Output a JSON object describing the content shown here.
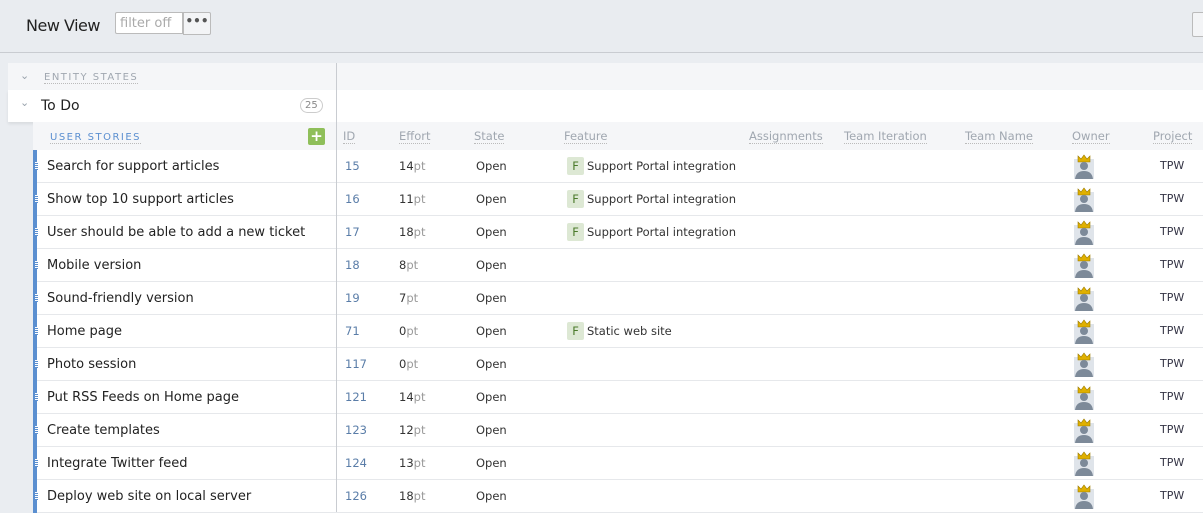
{
  "header": {
    "title": "New View",
    "filter_placeholder": "filter off",
    "more_label": "•••"
  },
  "groups": {
    "entity_states_label": "ENTITY STATES",
    "todo_label": "To Do",
    "todo_count": "25",
    "user_stories_label": "USER STORIES",
    "add_label": "+"
  },
  "columns": [
    "ID",
    "Effort",
    "State",
    "Feature",
    "Assignments",
    "Team Iteration",
    "Team Name",
    "Owner",
    "Project"
  ],
  "colors": {
    "accent": "#5b8fd0",
    "add": "#8fbf5a",
    "feature_badge": "#dde8d4"
  },
  "rows": [
    {
      "name": "Search for support articles",
      "id": "15",
      "effort": "14",
      "unit": "pt",
      "state": "Open",
      "feature": "Support Portal integration",
      "project": "TPW"
    },
    {
      "name": "Show top 10 support articles",
      "id": "16",
      "effort": "11",
      "unit": "pt",
      "state": "Open",
      "feature": "Support Portal integration",
      "project": "TPW"
    },
    {
      "name": "User should be able to add a new ticket",
      "id": "17",
      "effort": "18",
      "unit": "pt",
      "state": "Open",
      "feature": "Support Portal integration",
      "project": "TPW"
    },
    {
      "name": "Mobile version",
      "id": "18",
      "effort": "8",
      "unit": "pt",
      "state": "Open",
      "feature": "",
      "project": "TPW"
    },
    {
      "name": "Sound-friendly version",
      "id": "19",
      "effort": "7",
      "unit": "pt",
      "state": "Open",
      "feature": "",
      "project": "TPW"
    },
    {
      "name": "Home page",
      "id": "71",
      "effort": "0",
      "unit": "pt",
      "state": "Open",
      "feature": "Static web site",
      "project": "TPW"
    },
    {
      "name": "Photo session",
      "id": "117",
      "effort": "0",
      "unit": "pt",
      "state": "Open",
      "feature": "",
      "project": "TPW"
    },
    {
      "name": "Put RSS Feeds on Home page",
      "id": "121",
      "effort": "14",
      "unit": "pt",
      "state": "Open",
      "feature": "",
      "project": "TPW"
    },
    {
      "name": "Create templates",
      "id": "123",
      "effort": "12",
      "unit": "pt",
      "state": "Open",
      "feature": "",
      "project": "TPW"
    },
    {
      "name": "Integrate Twitter feed",
      "id": "124",
      "effort": "13",
      "unit": "pt",
      "state": "Open",
      "feature": "",
      "project": "TPW"
    },
    {
      "name": "Deploy web site on local server",
      "id": "126",
      "effort": "18",
      "unit": "pt",
      "state": "Open",
      "feature": "",
      "project": "TPW"
    }
  ],
  "feature_badge_letter": "F"
}
